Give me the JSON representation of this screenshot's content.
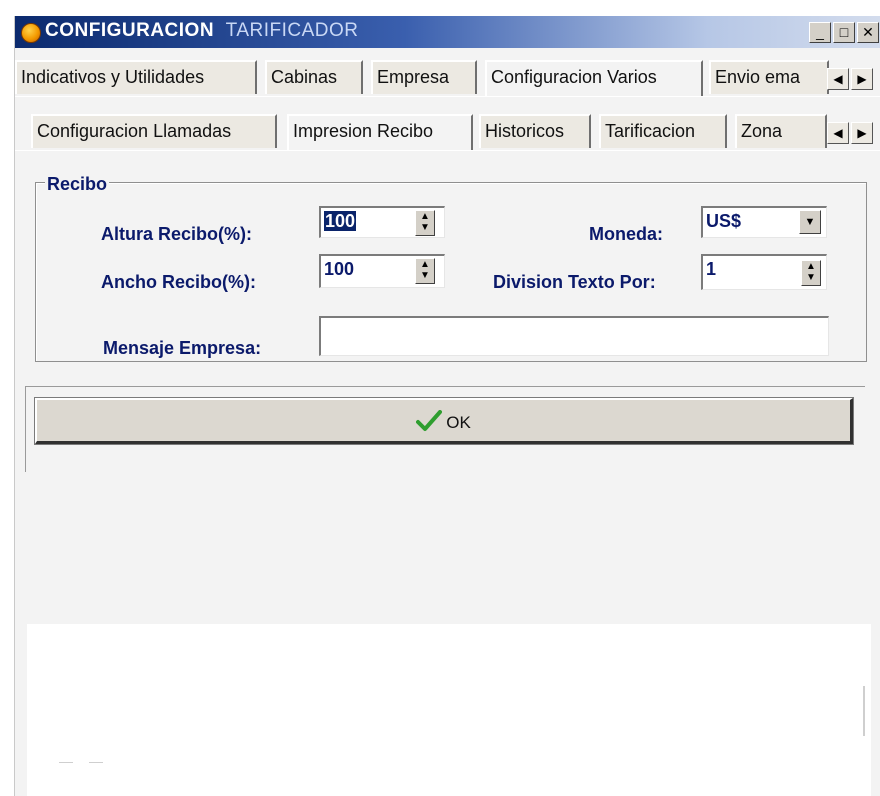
{
  "window": {
    "title_part1": "CONFIGURACION",
    "title_part2": "TARIFICADOR",
    "minimize_label": "_",
    "maximize_label": "□",
    "close_label": "✕"
  },
  "tabs_row1": [
    "Indicativos y Utilidades",
    "Cabinas",
    "Empresa",
    "Configuracion Varios",
    "Envio ema"
  ],
  "tabs_row2": [
    "Configuracion Llamadas",
    "Impresion Recibo",
    "Historicos",
    "Tarificacion",
    "Zona"
  ],
  "active_tab_row1": "Configuracion Varios",
  "active_tab_row2": "Impresion Recibo",
  "scroll": {
    "left": "◀",
    "right": "▶"
  },
  "recibo": {
    "legend": "Recibo",
    "altura_label": "Altura Recibo(%):",
    "altura_value": "100",
    "ancho_label": "Ancho Recibo(%):",
    "ancho_value": "100",
    "moneda_label": "Moneda:",
    "moneda_value": "US$",
    "division_label": "Division Texto Por:",
    "division_value": "1",
    "mensaje_label": "Mensaje Empresa:",
    "mensaje_value": ""
  },
  "ok_button": {
    "label": "OK",
    "icon": "checkmark-icon"
  },
  "colors": {
    "label_text": "#0b1a6b",
    "title_gradient_start": "#0b2a6e",
    "check_green": "#2f9e2f"
  }
}
